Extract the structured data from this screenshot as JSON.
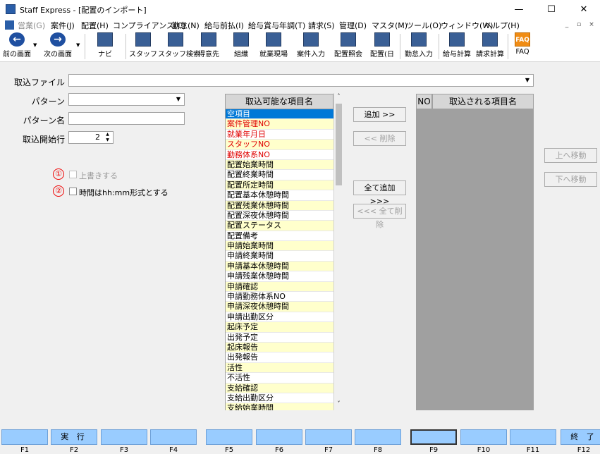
{
  "window": {
    "title": "Staff Express - [配置のインポート]",
    "minimize": "—",
    "maximize": "☐",
    "close": "✕"
  },
  "menu": [
    {
      "label": "営業(G)",
      "disabled": true
    },
    {
      "label": "案件(J)"
    },
    {
      "label": "配置(H)"
    },
    {
      "label": "コンプライアンス(C)"
    },
    {
      "label": "勤怠(N)"
    },
    {
      "label": "給与前払(I)"
    },
    {
      "label": "給与賞与年調(T)"
    },
    {
      "label": "請求(S)"
    },
    {
      "label": "管理(D)"
    },
    {
      "label": "マスタ(M)"
    },
    {
      "label": "ツール(O)"
    },
    {
      "label": "ウィンドウ(W)"
    },
    {
      "label": "ヘルプ(H)"
    }
  ],
  "mdi": {
    "min": "_",
    "restore": "▫",
    "close": "×"
  },
  "toolbar": [
    {
      "label": "前の画面",
      "icon": "back-arrow-icon"
    },
    {
      "label": "次の画面",
      "icon": "forward-arrow-icon"
    },
    {
      "label": "ナビ",
      "icon": "navi-icon"
    },
    {
      "label": "スタッフ",
      "icon": "staff-icon"
    },
    {
      "label": "スタッフ検索",
      "icon": "staff-search-icon"
    },
    {
      "label": "得意先",
      "icon": "customer-icon"
    },
    {
      "label": "組織",
      "icon": "organization-icon"
    },
    {
      "label": "就業現場",
      "icon": "worksite-icon"
    },
    {
      "label": "案件入力",
      "icon": "case-entry-icon"
    },
    {
      "label": "配置照会",
      "icon": "assignment-inquiry-icon"
    },
    {
      "label": "配置(日",
      "icon": "assignment-daily-icon"
    },
    {
      "label": "勤怠入力",
      "icon": "attendance-entry-icon"
    },
    {
      "label": "給与計算",
      "icon": "payroll-icon"
    },
    {
      "label": "請求計算",
      "icon": "billing-icon"
    },
    {
      "label": "FAQ",
      "icon": "faq-icon"
    }
  ],
  "form": {
    "import_file_label": "取込ファイル",
    "import_file_value": "",
    "pattern_label": "パターン",
    "pattern_value": "",
    "pattern_name_label": "パターン名",
    "pattern_name_value": "",
    "start_row_label": "取込開始行",
    "start_row_value": "2",
    "overwrite_label": "上書きする",
    "overwrite_marker": "①",
    "time_format_label": "時間はhh:mm形式とする",
    "time_format_marker": "②"
  },
  "available": {
    "header": "取込可能な項目名",
    "items": [
      {
        "text": "空項目",
        "bg": "#0078d7",
        "fg": "#ffffff"
      },
      {
        "text": "案件管理NO",
        "bg": "#ffffcc",
        "fg": "#e00000"
      },
      {
        "text": "就業年月日",
        "bg": "#ffffff",
        "fg": "#e00000"
      },
      {
        "text": "スタッフNO",
        "bg": "#ffffcc",
        "fg": "#e00000"
      },
      {
        "text": "勤務体系NO",
        "bg": "#ffffff",
        "fg": "#e00000"
      },
      {
        "text": "配置始業時間",
        "bg": "#ffffcc",
        "fg": "#000000"
      },
      {
        "text": "配置終業時間",
        "bg": "#ffffff",
        "fg": "#000000"
      },
      {
        "text": "配置所定時間",
        "bg": "#ffffcc",
        "fg": "#000000"
      },
      {
        "text": "配置基本休憩時間",
        "bg": "#ffffff",
        "fg": "#000000"
      },
      {
        "text": "配置残業休憩時間",
        "bg": "#ffffcc",
        "fg": "#000000"
      },
      {
        "text": "配置深夜休憩時間",
        "bg": "#ffffff",
        "fg": "#000000"
      },
      {
        "text": "配置ステータス",
        "bg": "#ffffcc",
        "fg": "#000000"
      },
      {
        "text": "配置備考",
        "bg": "#ffffff",
        "fg": "#000000"
      },
      {
        "text": "申請始業時間",
        "bg": "#ffffcc",
        "fg": "#000000"
      },
      {
        "text": "申請終業時間",
        "bg": "#ffffff",
        "fg": "#000000"
      },
      {
        "text": "申請基本休憩時間",
        "bg": "#ffffcc",
        "fg": "#000000"
      },
      {
        "text": "申請残業休憩時間",
        "bg": "#ffffff",
        "fg": "#000000"
      },
      {
        "text": "申請確認",
        "bg": "#ffffcc",
        "fg": "#000000"
      },
      {
        "text": "申請勤務体系NO",
        "bg": "#ffffff",
        "fg": "#000000"
      },
      {
        "text": "申請深夜休憩時間",
        "bg": "#ffffcc",
        "fg": "#000000"
      },
      {
        "text": "申請出勤区分",
        "bg": "#ffffff",
        "fg": "#000000"
      },
      {
        "text": "起床予定",
        "bg": "#ffffcc",
        "fg": "#000000"
      },
      {
        "text": "出発予定",
        "bg": "#ffffff",
        "fg": "#000000"
      },
      {
        "text": "起床報告",
        "bg": "#ffffcc",
        "fg": "#000000"
      },
      {
        "text": "出発報告",
        "bg": "#ffffff",
        "fg": "#000000"
      },
      {
        "text": "活性",
        "bg": "#ffffcc",
        "fg": "#000000"
      },
      {
        "text": "不活性",
        "bg": "#ffffff",
        "fg": "#000000"
      },
      {
        "text": "支給確認",
        "bg": "#ffffcc",
        "fg": "#000000"
      },
      {
        "text": "支給出勤区分",
        "bg": "#ffffff",
        "fg": "#000000"
      },
      {
        "text": "支給始業時間",
        "bg": "#ffffcc",
        "fg": "#000000"
      }
    ]
  },
  "buttons": {
    "add": "追加 >>",
    "remove": "<< 削除",
    "add_all": "全て追加 >>>",
    "remove_all": "<<< 全て削除",
    "move_up": "上へ移動",
    "move_down": "下へ移動"
  },
  "imported": {
    "no_header": "NO",
    "name_header": "取込される項目名"
  },
  "fkeys": [
    {
      "label": "",
      "key": "F1"
    },
    {
      "label": "実 行",
      "key": "F2"
    },
    {
      "label": "",
      "key": "F3"
    },
    {
      "label": "",
      "key": "F4"
    },
    {
      "label": "",
      "key": "F5"
    },
    {
      "label": "",
      "key": "F6"
    },
    {
      "label": "",
      "key": "F7"
    },
    {
      "label": "",
      "key": "F8"
    },
    {
      "label": "",
      "key": "F9"
    },
    {
      "label": "",
      "key": "F10"
    },
    {
      "label": "",
      "key": "F11"
    },
    {
      "label": "終 了",
      "key": "F12"
    }
  ]
}
